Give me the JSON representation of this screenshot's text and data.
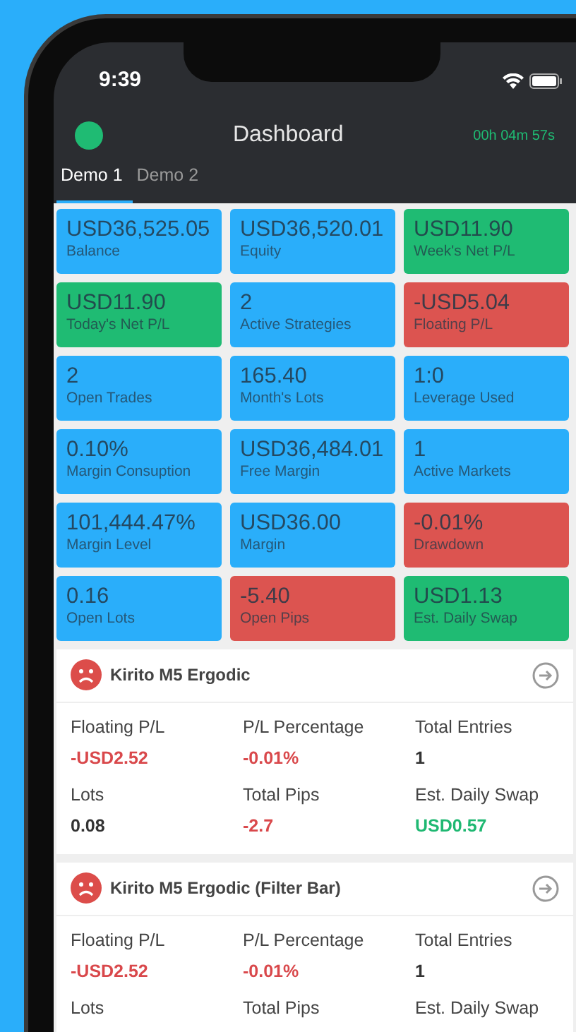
{
  "status_bar": {
    "time": "9:39"
  },
  "header": {
    "connected": true,
    "title": "Dashboard",
    "timer": "00h 04m 57s"
  },
  "tabs": [
    {
      "label": "Demo 1",
      "selected": true
    },
    {
      "label": "Demo 2",
      "selected": false
    }
  ],
  "tiles": [
    {
      "value": "USD36,525.05",
      "label": "Balance",
      "color": "#2aaefa"
    },
    {
      "value": "USD36,520.01",
      "label": "Equity",
      "color": "#2aaefa"
    },
    {
      "value": "USD11.90",
      "label": "Week's Net P/L",
      "color": "#1fbb73"
    },
    {
      "value": "USD11.90",
      "label": "Today's Net P/L",
      "color": "#1fbb73"
    },
    {
      "value": "2",
      "label": "Active Strategies",
      "color": "#2aaefa"
    },
    {
      "value": "-USD5.04",
      "label": "Floating P/L",
      "color": "#dc5450"
    },
    {
      "value": "2",
      "label": "Open Trades",
      "color": "#2aaefa"
    },
    {
      "value": "165.40",
      "label": "Month's Lots",
      "color": "#2aaefa"
    },
    {
      "value": "1:0",
      "label": "Leverage Used",
      "color": "#2aaefa"
    },
    {
      "value": "0.10%",
      "label": "Margin Consuption",
      "color": "#2aaefa"
    },
    {
      "value": "USD36,484.01",
      "label": "Free Margin",
      "color": "#2aaefa"
    },
    {
      "value": "1",
      "label": "Active Markets",
      "color": "#2aaefa"
    },
    {
      "value": "101,444.47%",
      "label": "Margin Level",
      "color": "#2aaefa"
    },
    {
      "value": "USD36.00",
      "label": "Margin",
      "color": "#2aaefa"
    },
    {
      "value": "-0.01%",
      "label": "Drawdown",
      "color": "#dc5450"
    },
    {
      "value": "0.16",
      "label": "Open Lots",
      "color": "#2aaefa"
    },
    {
      "value": "-5.40",
      "label": "Open Pips",
      "color": "#dc5450"
    },
    {
      "value": "USD1.13",
      "label": "Est. Daily Swap",
      "color": "#1fbb73"
    }
  ],
  "strategies": [
    {
      "name": "Kirito M5 Ergodic",
      "kind": "sad",
      "fields": [
        {
          "label": "Floating P/L",
          "value": "-USD2.52",
          "color": "#d9484b"
        },
        {
          "label": "P/L Percentage",
          "value": "-0.01%",
          "color": "#d9484b"
        },
        {
          "label": "Total Entries",
          "value": "1",
          "color": "#333333"
        },
        {
          "label": "Lots",
          "value": "0.08",
          "color": "#333333"
        },
        {
          "label": "Total Pips",
          "value": "-2.7",
          "color": "#d9484b"
        },
        {
          "label": "Est. Daily Swap",
          "value": "USD0.57",
          "color": "#1fb872"
        }
      ]
    },
    {
      "name": "Kirito M5 Ergodic (Filter Bar)",
      "kind": "sad",
      "fields": [
        {
          "label": "Floating P/L",
          "value": "-USD2.52",
          "color": "#d9484b"
        },
        {
          "label": "P/L Percentage",
          "value": "-0.01%",
          "color": "#d9484b"
        },
        {
          "label": "Total Entries",
          "value": "1",
          "color": "#333333"
        },
        {
          "label": "Lots"
        },
        {
          "label": "Total Pips"
        },
        {
          "label": "Est. Daily Swap"
        }
      ]
    }
  ]
}
